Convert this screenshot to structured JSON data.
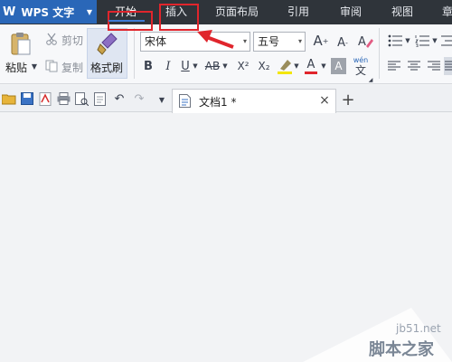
{
  "app": {
    "name": "WPS 文字",
    "logo": "W"
  },
  "menu_tabs": [
    "开始",
    "插入",
    "页面布局",
    "引用",
    "审阅",
    "视图",
    "章"
  ],
  "ribbon": {
    "paste_label": "粘贴",
    "cut_label": "剪切",
    "copy_label": "复制",
    "format_painter_label": "格式刷",
    "font_name": "宋体",
    "font_size": "五号",
    "bold": "B",
    "italic": "I",
    "underline": "U",
    "strike": "AB",
    "superscript": "X²",
    "subscript": "X₂",
    "font_color": "A",
    "char_shade": "A",
    "pinyin": "wén",
    "pinyin_char": "文",
    "grow_font": "A",
    "shrink_font": "A"
  },
  "document_tab": {
    "name": "文档1 *",
    "close": "×",
    "new": "+"
  },
  "watermark": {
    "url": "jb51.net",
    "site": "脚本之家"
  },
  "colors": {
    "menubar": "#2f343a",
    "app_button": "#2a67b8",
    "annotation": "#e0252c"
  }
}
